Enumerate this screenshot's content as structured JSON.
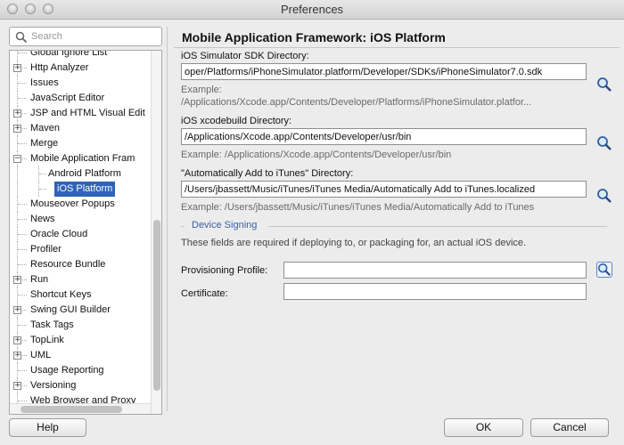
{
  "window": {
    "title": "Preferences"
  },
  "search": {
    "placeholder": "Search",
    "value": ""
  },
  "tree": {
    "items": [
      {
        "label": "Global Ignore List",
        "expandable": false
      },
      {
        "label": "Http Analyzer",
        "expandable": true
      },
      {
        "label": "Issues",
        "expandable": false
      },
      {
        "label": "JavaScript Editor",
        "expandable": false
      },
      {
        "label": "JSP and HTML Visual Edit",
        "expandable": true
      },
      {
        "label": "Maven",
        "expandable": true
      },
      {
        "label": "Merge",
        "expandable": false
      },
      {
        "label": "Mobile Application Fram",
        "expandable": true,
        "expanded": true
      },
      {
        "label": "Android Platform",
        "child": true
      },
      {
        "label": "iOS Platform",
        "child": true,
        "selected": true
      },
      {
        "label": "Mouseover Popups",
        "expandable": false
      },
      {
        "label": "News",
        "expandable": false
      },
      {
        "label": "Oracle Cloud",
        "expandable": false
      },
      {
        "label": "Profiler",
        "expandable": false
      },
      {
        "label": "Resource Bundle",
        "expandable": false
      },
      {
        "label": "Run",
        "expandable": true
      },
      {
        "label": "Shortcut Keys",
        "expandable": false
      },
      {
        "label": "Swing GUI Builder",
        "expandable": true
      },
      {
        "label": "Task Tags",
        "expandable": false
      },
      {
        "label": "TopLink",
        "expandable": true
      },
      {
        "label": "UML",
        "expandable": true
      },
      {
        "label": "Usage Reporting",
        "expandable": false
      },
      {
        "label": "Versioning",
        "expandable": true
      },
      {
        "label": "Web Browser and Proxy",
        "expandable": false
      }
    ]
  },
  "main": {
    "title": "Mobile Application Framework: iOS Platform",
    "sdk_dir": {
      "label": "iOS Simulator SDK Directory:",
      "value": "oper/Platforms/iPhoneSimulator.platform/Developer/SDKs/iPhoneSimulator7.0.sdk",
      "example_label": "Example:",
      "example": "/Applications/Xcode.app/Contents/Developer/Platforms/iPhoneSimulator.platfor..."
    },
    "xcodebuild_dir": {
      "label": "iOS xcodebuild Directory:",
      "value": "/Applications/Xcode.app/Contents/Developer/usr/bin",
      "example": "Example: /Applications/Xcode.app/Contents/Developer/usr/bin"
    },
    "itunes_dir": {
      "label": "\"Automatically Add to iTunes\" Directory:",
      "value": "/Users/jbassett/Music/iTunes/iTunes Media/Automatically Add to iTunes.localized",
      "example": "Example: /Users/jbassett/Music/iTunes/iTunes Media/Automatically Add to iTunes"
    },
    "signing": {
      "title": "Device Signing",
      "description": "These fields are required if deploying to, or packaging for, an actual iOS device.",
      "profile_label": "Provisioning Profile:",
      "profile_value": "",
      "certificate_label": "Certificate:",
      "certificate_value": ""
    }
  },
  "buttons": {
    "help": "Help",
    "ok": "OK",
    "cancel": "Cancel"
  },
  "icons": {
    "browse": "magnifier-icon",
    "search": "search-icon"
  },
  "colors": {
    "selection": "#2f63b7",
    "section_title": "#3a5fa8"
  }
}
